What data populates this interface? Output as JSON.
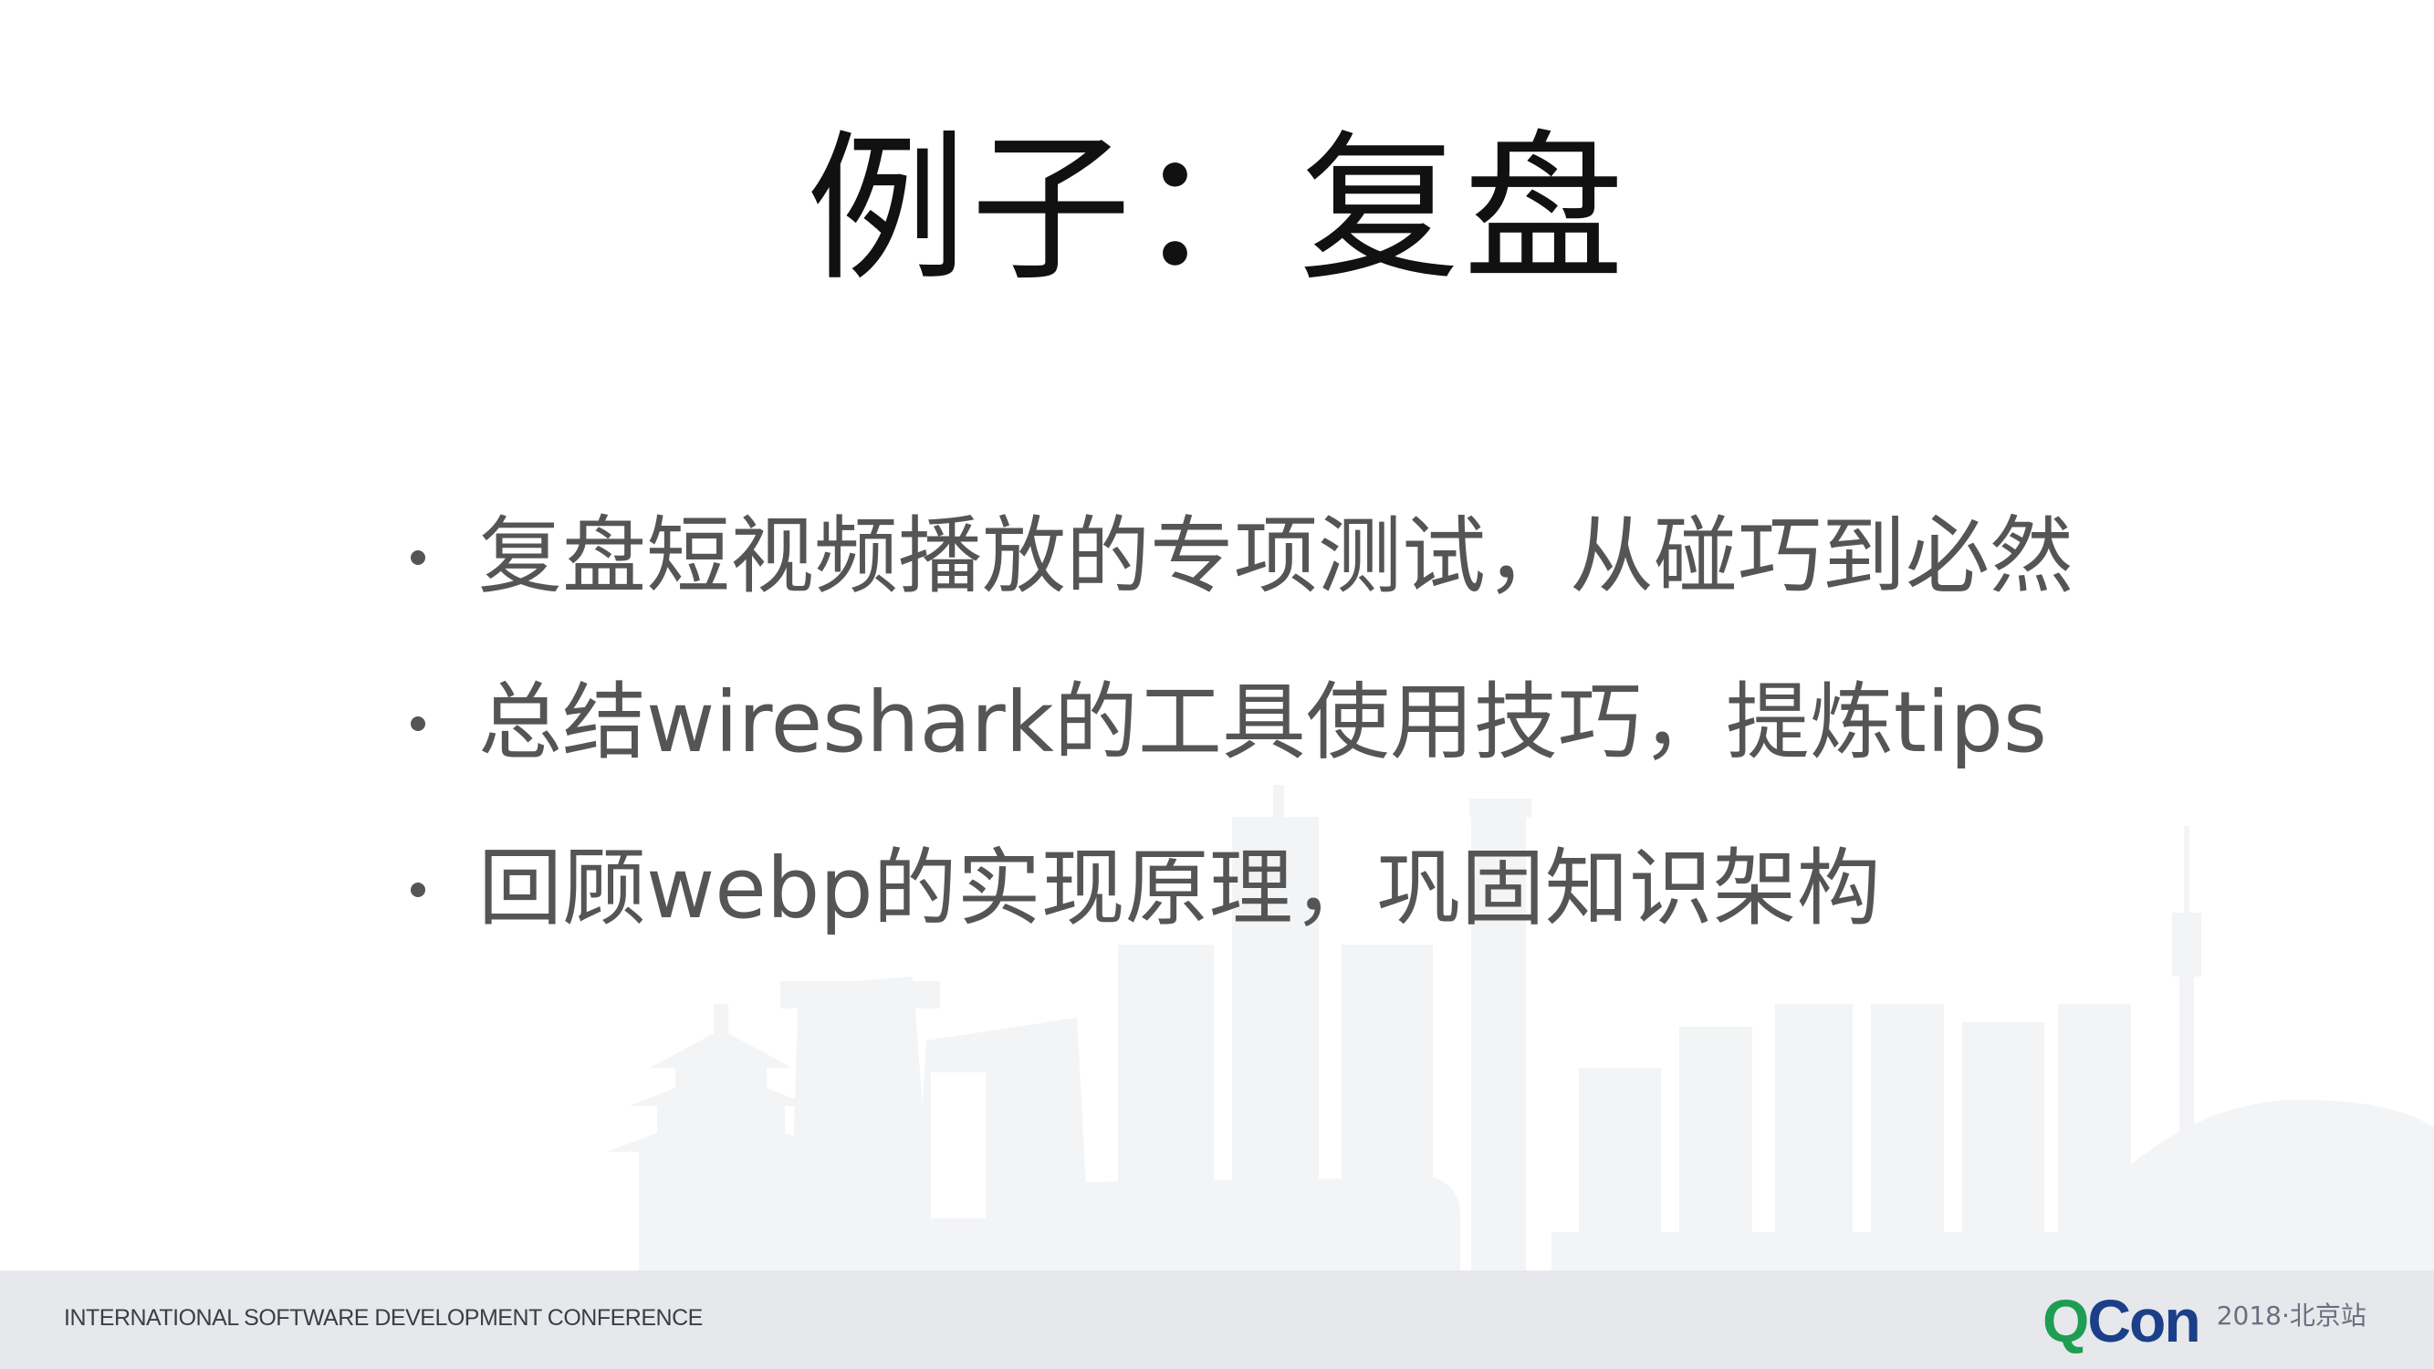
{
  "slide": {
    "title": "例子：复盘",
    "bullets": [
      "复盘短视频播放的专项测试，从碰巧到必然",
      "总结wireshark的工具使用技巧，提炼tips",
      "回顾webp的实现原理，巩固知识架构"
    ]
  },
  "footer": {
    "conference": "INTERNATIONAL SOFTWARE DEVELOPMENT CONFERENCE",
    "logo_q": "Q",
    "logo_con": "Con",
    "event": "2018·北京站"
  },
  "colors": {
    "title": "#111111",
    "bullet_text": "#555555",
    "footer_bg": "#e6e8eb",
    "logo_green": "#1e9e52",
    "logo_blue": "#1c3f8a",
    "skyline": "#f1f2f4"
  }
}
